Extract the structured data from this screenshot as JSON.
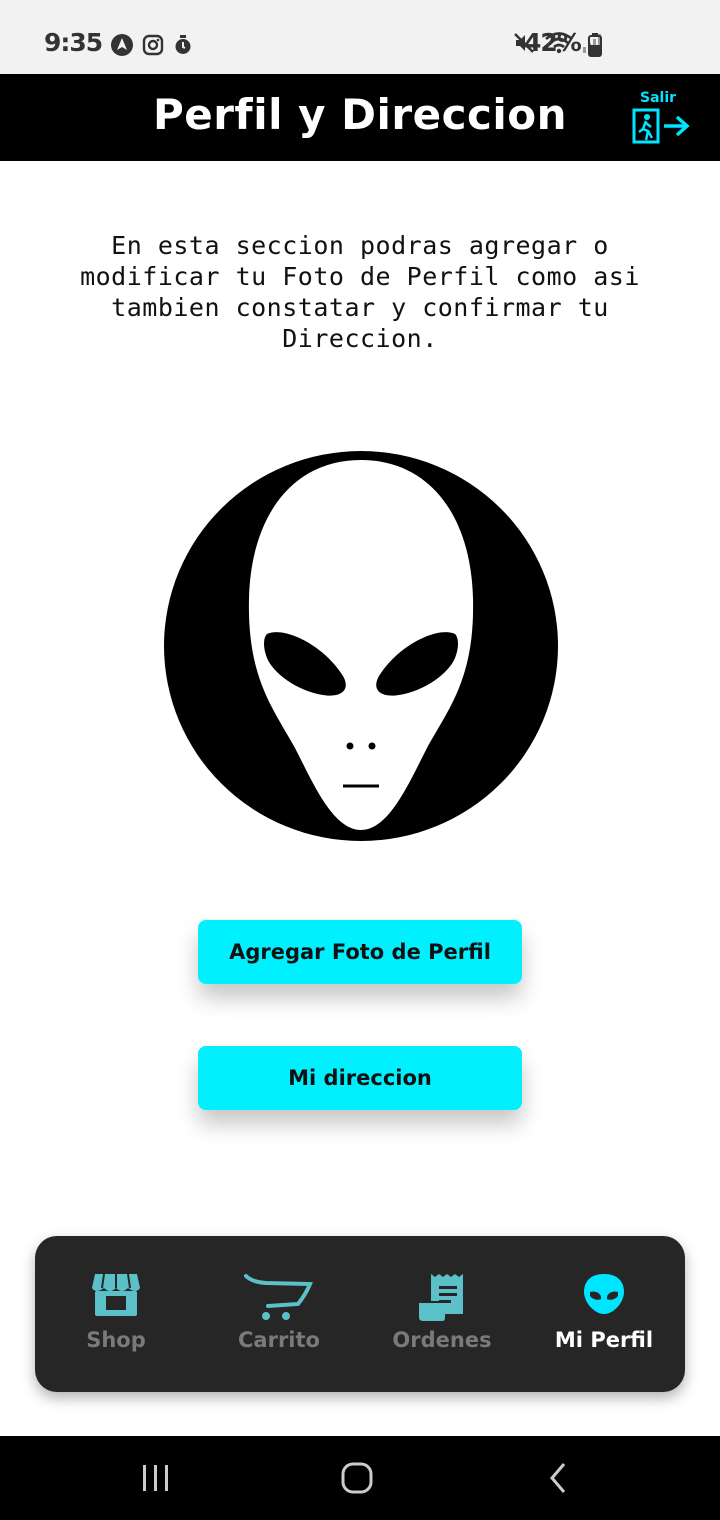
{
  "status_bar": {
    "time": "9:35",
    "battery": "42%",
    "icons": [
      "navigation-icon",
      "instagram-icon",
      "timer-icon",
      "mute-icon",
      "wifi-icon",
      "signal-icon",
      "battery-icon"
    ]
  },
  "header": {
    "title": "Perfil y Direccion",
    "logout_label": "Salir",
    "logout_icon": "exit-door-icon"
  },
  "main": {
    "description": "En esta seccion podras agregar o modificar tu Foto de Perfil como asi tambien constatar y confirmar tu Direccion.",
    "avatar_icon": "alien-avatar-icon",
    "buttons": {
      "add_photo": "Agregar Foto de Perfil",
      "my_address": "Mi direccion"
    }
  },
  "bottom_nav": {
    "items": [
      {
        "label": "Shop",
        "icon": "store-icon",
        "active": false
      },
      {
        "label": "Carrito",
        "icon": "cart-icon",
        "active": false
      },
      {
        "label": "Ordenes",
        "icon": "receipt-icon",
        "active": false
      },
      {
        "label": "Mi Perfil",
        "icon": "alien-icon",
        "active": true
      }
    ]
  },
  "colors": {
    "accent": "#00f0ff",
    "header_bg": "#000000",
    "nav_bg": "#262626",
    "nav_icon": "#5bc0c8",
    "nav_inactive_text": "#7a7a7a"
  }
}
